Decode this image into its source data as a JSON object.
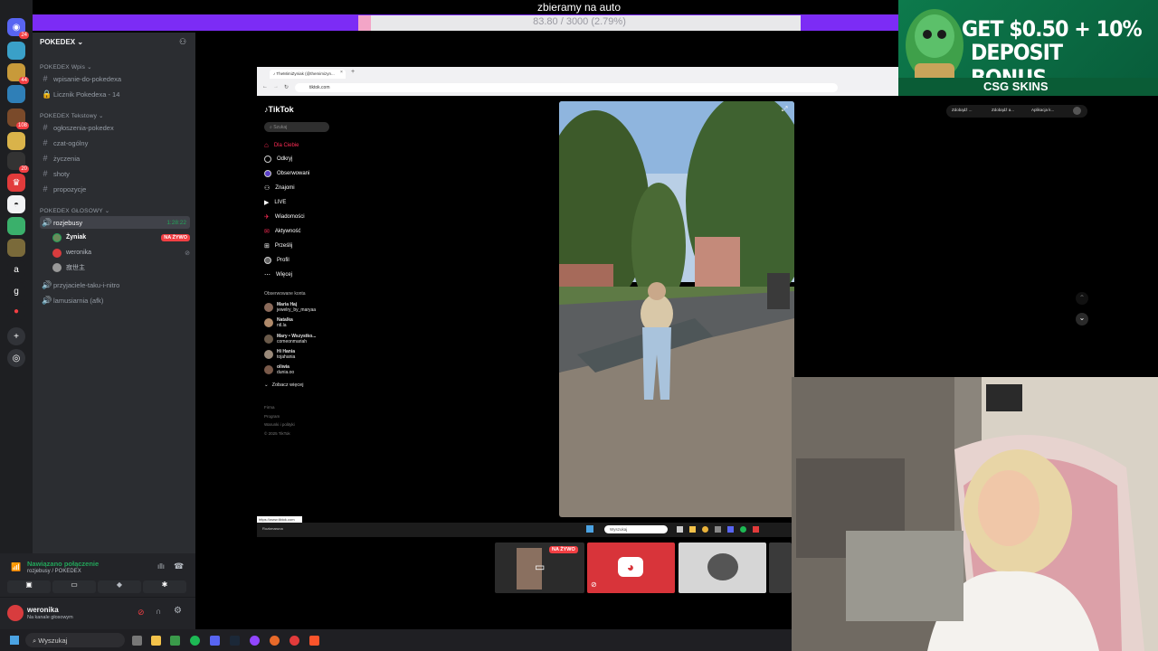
{
  "stream_goal": {
    "title": "zbieramy na auto",
    "progress_text": "83.80 / 3000 (2.79%)",
    "progress": 0.0279
  },
  "server_rail": {
    "badges": [
      "24",
      "44",
      "108",
      "20"
    ]
  },
  "guild": {
    "name": "POKEDEX",
    "categories": [
      {
        "label": "POKEDEX Wpis",
        "channels": [
          "wpisanie-do-pokedexa",
          "Licznik Pokedexa - 14"
        ]
      },
      {
        "label": "POKEDEX Tekstowy",
        "channels": [
          "ogłoszenia-pokedex",
          "czat-ogólny",
          "życzenia",
          "shoty",
          "propozycje"
        ]
      },
      {
        "label": "POKEDEX GŁOSOWY",
        "channels": []
      }
    ],
    "voice_channel": {
      "name": "rozjebusy",
      "timer": "1:28:22",
      "users": [
        {
          "name": "Żyniak",
          "live": "NA ŻYWO"
        },
        {
          "name": "weronika"
        },
        {
          "name": "寂世主"
        }
      ]
    },
    "more_voice": [
      "przyjaciele-taku-i-nitro",
      "lamusiarnia (afk)"
    ]
  },
  "voice_status": {
    "title": "Nawiązano połączenie",
    "subtitle": "rozjebusy / POKEDEX"
  },
  "user": {
    "name": "weronika",
    "status": "Na kanale głosowym"
  },
  "browser": {
    "tab_title": "TheMimiZyniak (@themimizyn...",
    "url": "tiktok.com",
    "status_url": "https://www.tiktok.com"
  },
  "tiktok": {
    "logo": "TikTok",
    "search_placeholder": "Szukaj",
    "nav": [
      "Dla Ciebie",
      "Odkryj",
      "Obserwowani",
      "Znajomi",
      "LIVE",
      "Wiadomości",
      "Aktywność",
      "Prześlij",
      "Profil",
      "Więcej"
    ],
    "followed_heading": "Obserwowane konta",
    "followed": [
      {
        "name": "Maria Haj",
        "handle": "jewelry_by_maryaa"
      },
      {
        "name": "Natalka",
        "handle": "ntl.la"
      },
      {
        "name": "Mary • Wszystko...",
        "handle": "comeonmariah"
      },
      {
        "name": "Hi Hania",
        "handle": "tojahania"
      },
      {
        "name": "oliwia",
        "handle": "dunia.oo"
      }
    ],
    "see_more": "Zobacz więcej",
    "footer": [
      "Firma",
      "Program",
      "Warunki i polityki",
      "© 2025 TikTok"
    ],
    "right_tabs": [
      "Zdobądź ...",
      "Zdobądź a...",
      "Aplikacja k..."
    ]
  },
  "inner_taskbar": {
    "search": "Wyszukaj",
    "weather": "Rozkmaruna"
  },
  "thumbs": {
    "live_badge": "NA ŻYWO"
  },
  "ad": {
    "line1": "GET $0.50 + 10%",
    "line2": "DEPOSIT BONUS",
    "brand": "CSG SKINS"
  },
  "taskbar": {
    "search": "Wyszukaj"
  }
}
